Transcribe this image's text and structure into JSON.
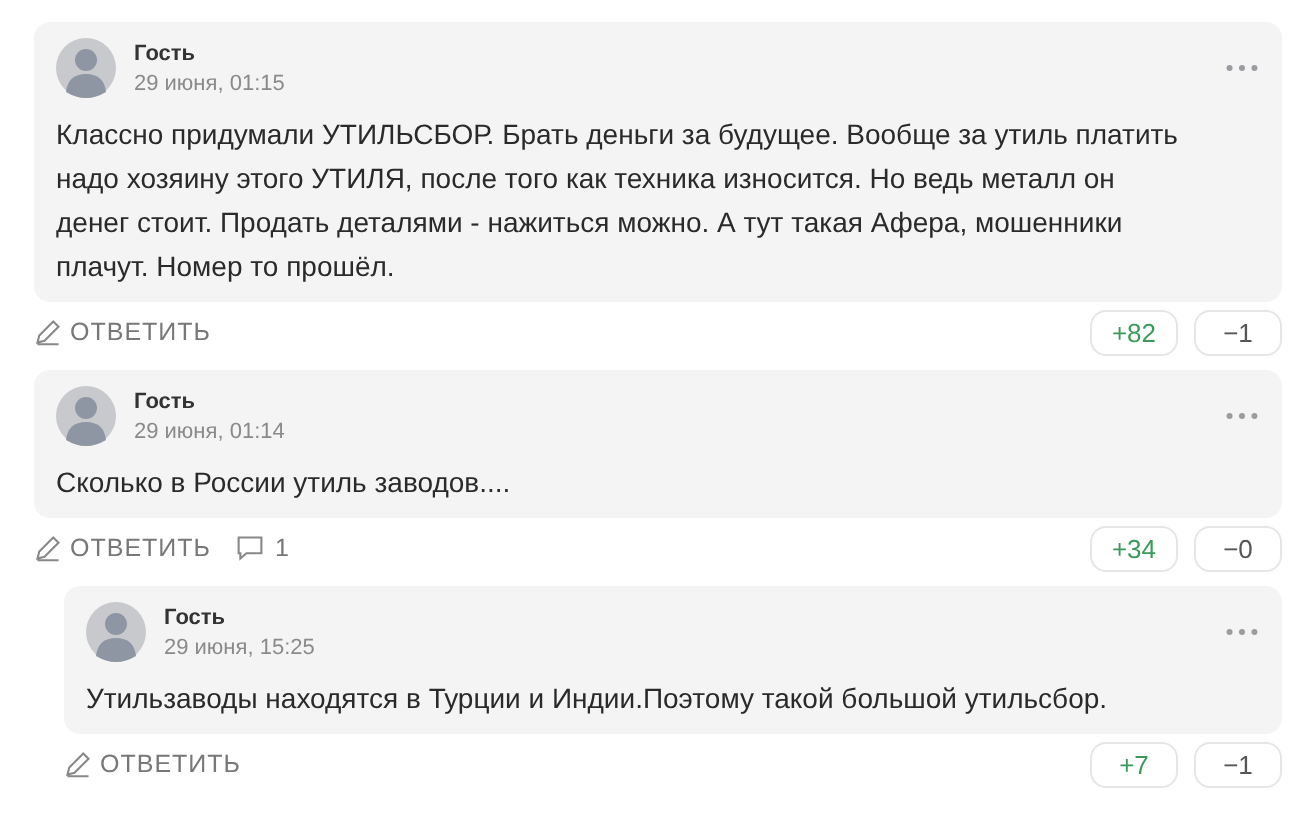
{
  "comments": [
    {
      "author": "Гость",
      "date": "29 июня, 01:15",
      "text": "Классно придумали УТИЛЬСБОР. Брать деньги за будущее. Вообще за утиль платить надо хозяину этого УТИЛЯ, после того как техника износится. Но ведь металл он денег стоит. Продать деталями - нажиться можно. А тут такая Афера, мошенники плачут. Номер то прошёл.",
      "reply_label": "ОТВЕТИТЬ",
      "upvotes": "+82",
      "downvotes": "−1"
    },
    {
      "author": "Гость",
      "date": "29 июня, 01:14",
      "text": "Сколько в России утиль заводов....",
      "reply_label": "ОТВЕТИТЬ",
      "reply_count": "1",
      "upvotes": "+34",
      "downvotes": "−0",
      "children": [
        {
          "author": "Гость",
          "date": "29 июня, 15:25",
          "text": "Утильзаводы находятся в Турции и Индии.Поэтому такой большой утильсбор.",
          "reply_label": "ОТВЕТИТЬ",
          "upvotes": "+7",
          "downvotes": "−1"
        }
      ]
    }
  ]
}
